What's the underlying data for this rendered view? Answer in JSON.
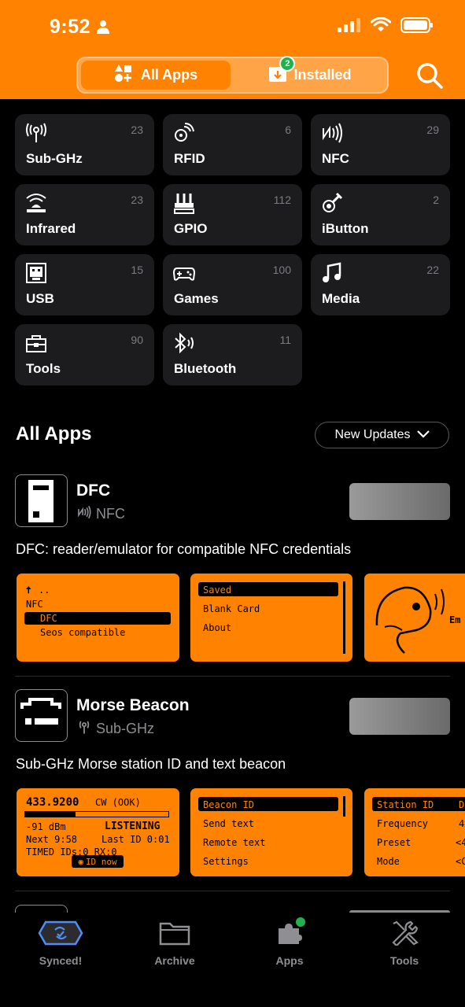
{
  "status_bar": {
    "time": "9:52"
  },
  "segment": {
    "all_apps_label": "All Apps",
    "installed_label": "Installed",
    "installed_badge": "2"
  },
  "categories": [
    {
      "name": "Sub-GHz",
      "count": "23"
    },
    {
      "name": "RFID",
      "count": "6"
    },
    {
      "name": "NFC",
      "count": "29"
    },
    {
      "name": "Infrared",
      "count": "23"
    },
    {
      "name": "GPIO",
      "count": "112"
    },
    {
      "name": "iButton",
      "count": "2"
    },
    {
      "name": "USB",
      "count": "15"
    },
    {
      "name": "Games",
      "count": "100"
    },
    {
      "name": "Media",
      "count": "22"
    },
    {
      "name": "Tools",
      "count": "90"
    },
    {
      "name": "Bluetooth",
      "count": "11"
    }
  ],
  "all_apps": {
    "title": "All Apps",
    "filter_label": "New Updates"
  },
  "apps": [
    {
      "name": "DFC",
      "category": "NFC",
      "description": "DFC: reader/emulator for compatible NFC credentials",
      "shot1": {
        "l1": "..",
        "l2": "NFC",
        "l3": "DFC",
        "l4": "Seos compatible"
      },
      "shot2": {
        "l1": "Saved",
        "l2": "Blank Card",
        "l3": "About"
      },
      "shot3": {
        "text": "Em"
      }
    },
    {
      "name": "Morse Beacon",
      "category": "Sub-GHz",
      "description": "Sub-GHz Morse station ID and text beacon",
      "shot1": {
        "freq": "433.9200",
        "mode": "CW (OOK)",
        "dbm": "-91 dBm",
        "state": "LISTENING",
        "next": "Next  9:58",
        "last": "Last ID  0:01",
        "timed": "TIMED  IDs:0  RX:0",
        "btn": "ID now"
      },
      "shot2": {
        "l1": "Beacon ID",
        "l2": "Send text",
        "l3": "Remote text",
        "l4": "Settings"
      },
      "shot3": {
        "l1": "Station ID",
        "l2": "Frequency",
        "l3": "Preset",
        "l4": "Mode",
        "v1": "D",
        "v2": "4",
        "v3": "<4",
        "v4": "<C"
      }
    }
  ],
  "tabs": [
    {
      "label": "Synced!"
    },
    {
      "label": "Archive"
    },
    {
      "label": "Apps"
    },
    {
      "label": "Tools"
    }
  ],
  "colors": {
    "accent": "#ff8200",
    "tile": "#1c1c1e",
    "success": "#23b14d"
  }
}
